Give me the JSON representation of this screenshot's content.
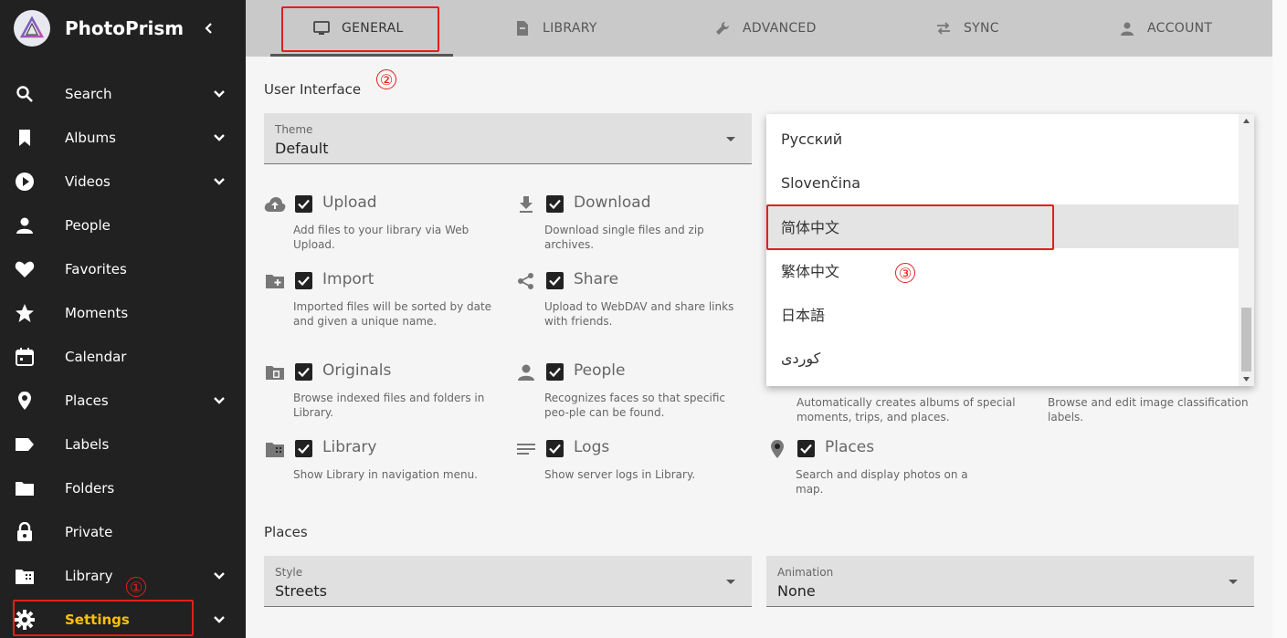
{
  "app": {
    "name": "PhotoPrism"
  },
  "sidebar": {
    "items": [
      {
        "label": "Search",
        "icon": "search-icon",
        "expandable": true
      },
      {
        "label": "Albums",
        "icon": "bookmark-icon",
        "expandable": true
      },
      {
        "label": "Videos",
        "icon": "play-circle-icon",
        "expandable": true
      },
      {
        "label": "People",
        "icon": "person-icon",
        "expandable": false
      },
      {
        "label": "Favorites",
        "icon": "heart-icon",
        "expandable": false
      },
      {
        "label": "Moments",
        "icon": "star-icon",
        "expandable": false
      },
      {
        "label": "Calendar",
        "icon": "calendar-icon",
        "expandable": false
      },
      {
        "label": "Places",
        "icon": "map-pin-icon",
        "expandable": true
      },
      {
        "label": "Labels",
        "icon": "label-icon",
        "expandable": false
      },
      {
        "label": "Folders",
        "icon": "folder-icon",
        "expandable": false
      },
      {
        "label": "Private",
        "icon": "lock-icon",
        "expandable": false
      },
      {
        "label": "Library",
        "icon": "film-folder-icon",
        "expandable": true
      },
      {
        "label": "Settings",
        "icon": "gear-icon",
        "expandable": true,
        "active": true
      }
    ]
  },
  "tabs": [
    {
      "label": "GENERAL",
      "icon": "monitor-icon",
      "active": true
    },
    {
      "label": "LIBRARY",
      "icon": "file-cabinet-icon"
    },
    {
      "label": "ADVANCED",
      "icon": "wrench-icon"
    },
    {
      "label": "SYNC",
      "icon": "sync-arrows-icon"
    },
    {
      "label": "ACCOUNT",
      "icon": "person-icon"
    }
  ],
  "user_interface": {
    "title": "User Interface",
    "theme": {
      "caption": "Theme",
      "value": "Default"
    }
  },
  "options": [
    {
      "title": "Upload",
      "desc": "Add files to your library via Web Upload.",
      "icon": "cloud-upload-icon",
      "checked": true
    },
    {
      "title": "Download",
      "desc": "Download single files and zip archives.",
      "icon": "download-icon",
      "checked": true
    },
    {
      "title": "Import",
      "desc": "Imported files will be sorted by date and given a unique name.",
      "icon": "folder-plus-icon",
      "checked": true
    },
    {
      "title": "Share",
      "desc": "Upload to WebDAV and share links with friends.",
      "icon": "share-icon",
      "checked": true
    },
    {
      "title": "Originals",
      "desc": "Browse indexed files and folders in Library.",
      "icon": "folder-file-icon",
      "checked": true
    },
    {
      "title": "People",
      "desc": "Recognizes faces so that specific peo-ple can be found.",
      "icon": "person-icon",
      "checked": true
    },
    {
      "title": "Library",
      "desc": "Show Library in navigation menu.",
      "icon": "film-folder-icon",
      "checked": true
    },
    {
      "title": "Logs",
      "desc": "Show server logs in Library.",
      "icon": "lines-icon",
      "checked": true
    },
    {
      "title": "Places",
      "desc": "Search and display photos on a map.",
      "icon": "map-pin-icon",
      "checked": true
    }
  ],
  "hidden_descs": [
    "Automatically creates albums of special moments, trips, and places.",
    "Browse and edit image classification labels."
  ],
  "language_dropdown": {
    "items": [
      "Русский",
      "Slovenčina",
      "简体中文",
      "繁体中文",
      "日本語",
      "کوردی"
    ],
    "highlighted_index": 2
  },
  "places": {
    "title": "Places",
    "style": {
      "caption": "Style",
      "value": "Streets"
    },
    "animation": {
      "caption": "Animation",
      "value": "None"
    }
  },
  "annotations": [
    "①",
    "②",
    "③"
  ],
  "colors": {
    "sidebar_bg": "#212121",
    "active": "#ffc107",
    "annotation": "#e0201d",
    "tabbar_bg": "#c9c9c9"
  }
}
